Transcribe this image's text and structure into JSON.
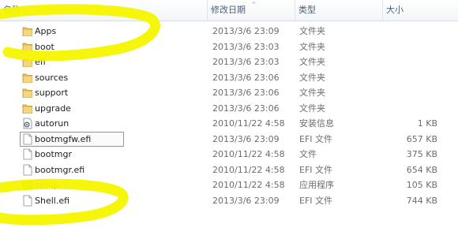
{
  "columns": {
    "name": "名称",
    "date": "修改日期",
    "type": "类型",
    "size": "大小"
  },
  "files": [
    {
      "name": "Apps",
      "date": "2013/3/6 23:09",
      "type": "文件夹",
      "size": "",
      "icon": "folder-icon"
    },
    {
      "name": "boot",
      "date": "2013/3/6 23:03",
      "type": "文件夹",
      "size": "",
      "icon": "folder-icon"
    },
    {
      "name": "efi",
      "date": "2013/3/6 23:03",
      "type": "文件夹",
      "size": "",
      "icon": "folder-icon"
    },
    {
      "name": "sources",
      "date": "2013/3/6 23:06",
      "type": "文件夹",
      "size": "",
      "icon": "folder-icon"
    },
    {
      "name": "support",
      "date": "2013/3/6 23:06",
      "type": "文件夹",
      "size": "",
      "icon": "folder-icon"
    },
    {
      "name": "upgrade",
      "date": "2013/3/6 23:06",
      "type": "文件夹",
      "size": "",
      "icon": "folder-icon"
    },
    {
      "name": "autorun",
      "date": "2010/11/22 4:58",
      "type": "安装信息",
      "size": "1 KB",
      "icon": "settings-file-icon"
    },
    {
      "name": "bootmgfw.efi",
      "date": "2013/3/6 23:09",
      "type": "EFI 文件",
      "size": "657 KB",
      "icon": "file-icon",
      "selected": true
    },
    {
      "name": "bootmgr",
      "date": "2010/11/22 4:58",
      "type": "文件",
      "size": "375 KB",
      "icon": "file-icon"
    },
    {
      "name": "bootmgr.efi",
      "date": "2010/11/22 4:58",
      "type": "EFI 文件",
      "size": "654 KB",
      "icon": "file-icon"
    },
    {
      "name": "setup",
      "date": "2010/11/22 4:58",
      "type": "应用程序",
      "size": "105 KB",
      "icon": "setup-app-icon"
    },
    {
      "name": "Shell.efi",
      "date": "2013/3/6 23:09",
      "type": "EFI 文件",
      "size": "744 KB",
      "icon": "file-icon"
    }
  ],
  "colors": {
    "highlighter": "#f5f500",
    "header_text": "#4c607a",
    "folder": "#e8c060"
  }
}
